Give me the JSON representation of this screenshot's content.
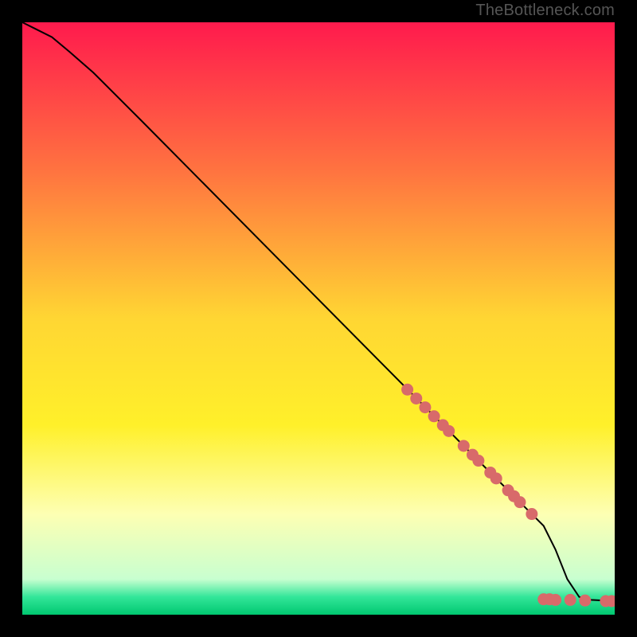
{
  "watermark": "TheBottleneck.com",
  "chart_data": {
    "type": "line",
    "title": "",
    "xlabel": "",
    "ylabel": "",
    "xlim": [
      0,
      100
    ],
    "ylim": [
      0,
      100
    ],
    "background_gradient_stops": [
      {
        "offset": 0.0,
        "color": "#ff1a4d"
      },
      {
        "offset": 0.25,
        "color": "#ff7340"
      },
      {
        "offset": 0.5,
        "color": "#ffd633"
      },
      {
        "offset": 0.68,
        "color": "#fff02a"
      },
      {
        "offset": 0.83,
        "color": "#fdffb3"
      },
      {
        "offset": 0.94,
        "color": "#c8ffd0"
      },
      {
        "offset": 0.97,
        "color": "#33e699"
      },
      {
        "offset": 1.0,
        "color": "#00c770"
      }
    ],
    "series": [
      {
        "name": "curve",
        "x": [
          0,
          2,
          5,
          8,
          12,
          20,
          40,
          60,
          76,
          86,
          88,
          90,
          92,
          94,
          96,
          98,
          100
        ],
        "y": [
          100,
          99,
          97.5,
          95,
          91.5,
          83.5,
          63.3,
          43.1,
          27,
          17,
          15,
          11,
          6,
          3,
          2.5,
          2.4,
          2.3
        ]
      }
    ],
    "markers": {
      "name": "highlighted-points",
      "color": "#d86a6a",
      "points": [
        {
          "x": 65,
          "y": 38
        },
        {
          "x": 66.5,
          "y": 36.5
        },
        {
          "x": 68,
          "y": 35
        },
        {
          "x": 69.5,
          "y": 33.5
        },
        {
          "x": 71,
          "y": 32
        },
        {
          "x": 72,
          "y": 31
        },
        {
          "x": 74.5,
          "y": 28.5
        },
        {
          "x": 76,
          "y": 27
        },
        {
          "x": 77,
          "y": 26
        },
        {
          "x": 79,
          "y": 24
        },
        {
          "x": 80,
          "y": 23
        },
        {
          "x": 82,
          "y": 21
        },
        {
          "x": 83,
          "y": 20
        },
        {
          "x": 84,
          "y": 19
        },
        {
          "x": 86,
          "y": 17
        },
        {
          "x": 88,
          "y": 2.6
        },
        {
          "x": 89,
          "y": 2.6
        },
        {
          "x": 90,
          "y": 2.5
        },
        {
          "x": 92.5,
          "y": 2.5
        },
        {
          "x": 95,
          "y": 2.4
        },
        {
          "x": 98.5,
          "y": 2.3
        },
        {
          "x": 99.5,
          "y": 2.3
        }
      ]
    }
  }
}
